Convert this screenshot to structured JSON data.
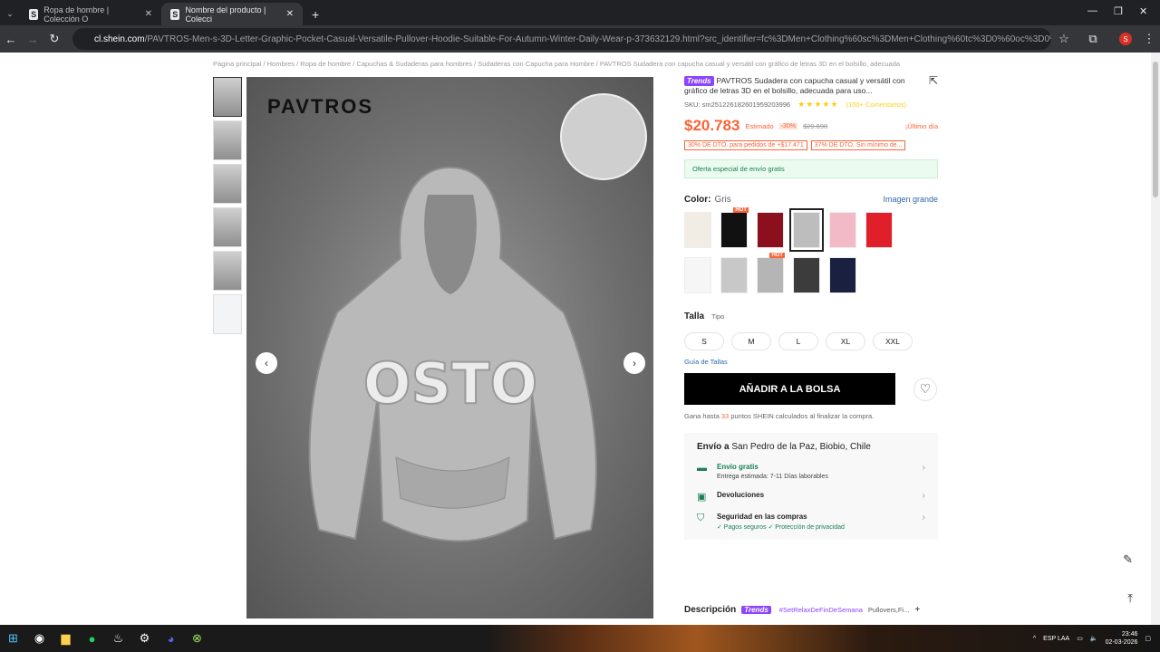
{
  "browser": {
    "tabs": [
      {
        "label": "Ropa de hombre | Colección O",
        "active": false
      },
      {
        "label": "Nombre del producto | Colecci",
        "active": true
      }
    ],
    "url_host": "cl.shein.com",
    "url_path": "/PAVTROS-Men-s-3D-Letter-Graphic-Pocket-Casual-Versatile-Pullover-Hoodie-Suitable-For-Autumn-Winter-Daily-Wear-p-373632129.html?src_identifier=fc%3DMen+Clothing%60sc%3DMen+Clothing%60tc%3D0%60oc%3D0%60ps%3Dtab08..."
  },
  "breadcrumb": "Página principal / Hombres / Ropa de hombre / Capuchas & Sudaderas para hombres / Sudaderas con Capucha para Hombre / PAVTROS Sudadera con capucha casual y versátil con gráfico de letras 3D en el bolsillo, adecuada",
  "image": {
    "brand": "PAVTROS",
    "print": "OSTO"
  },
  "product": {
    "badge": "Trends",
    "title": "PAVTROS Sudadera con capucha casual y versátil con gráfico de letras 3D en el bolsillo, adecuada para uso...",
    "sku": "SKU: sm2512261826019592039​96",
    "reviews": "(100+ Comentarios)",
    "stars": "★★★★★",
    "price": "$20.783",
    "estimado": "Estimado",
    "pct": "-30%",
    "old_price": "$29.690",
    "last_day": "¡Último día",
    "coupons": [
      "30% DE DTO. para pedidos de +$17.471",
      "37% DE DTO. Sin mínimo de..."
    ],
    "ship_offer": "Oferta especial de envío gratis"
  },
  "color": {
    "label": "Color:",
    "value": "Gris",
    "big_image": "Imagen grande",
    "hot": "HOT",
    "swatches": [
      "#f1ece4",
      "#111111",
      "#8b0f1c",
      "#bdbdbd",
      "#f2b9c6",
      "#e01f2a",
      "#f6f6f6",
      "#c8c8c8",
      "#b5b5b5",
      "#3c3c3c",
      "#1a2040"
    ]
  },
  "size": {
    "label": "Talla",
    "tipo": "Tipo",
    "options": [
      "S",
      "M",
      "L",
      "XL",
      "XXL"
    ],
    "guide": "Guía de Tallas"
  },
  "cart": {
    "add": "AÑADIR A LA BOLSA",
    "points_pre": "Gana hasta",
    "points_num": "33",
    "points_post": "puntos SHEIN calculados al finalizar la compra."
  },
  "shipping": {
    "label": "Envío a",
    "place": "San Pedro de la Paz, Biobio, Chile",
    "free": "Envío gratis",
    "eta": "Entrega estimada: 7-11 Días laborables",
    "returns": "Devoluciones",
    "security": "Seguridad en las compras",
    "safe_pay": "✓ Pagos seguros",
    "privacy": "✓ Protección de privacidad"
  },
  "description": {
    "label": "Descripción",
    "badge": "Trends",
    "tag": "#SetRelaxDeFinDeSemana",
    "more": "Pullovers,Fi..."
  },
  "taskbar": {
    "lang": "ESP LAA",
    "time": "23:46",
    "date": "02-03-2026"
  }
}
